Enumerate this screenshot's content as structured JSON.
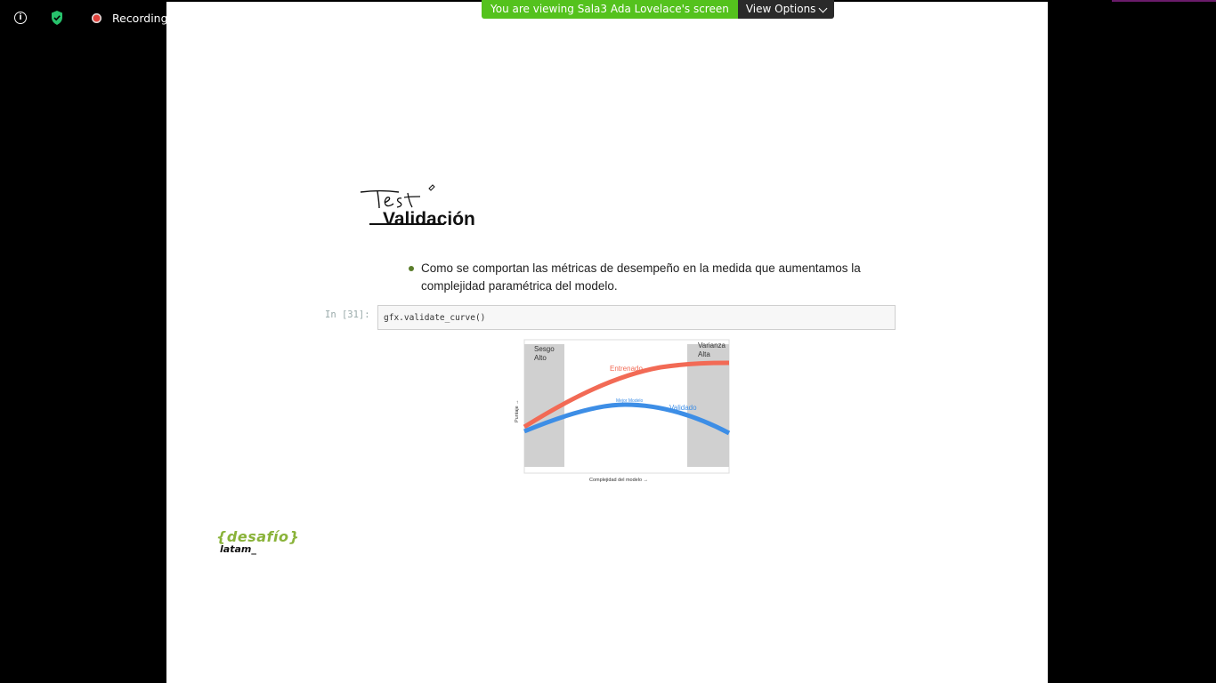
{
  "toolbar": {
    "info_icon": "info-icon",
    "shield_icon": "shield-icon",
    "recording_label": "Recording"
  },
  "share_banner": {
    "text": "You are viewing Sala3 Ada Lovelace's screen",
    "view_options_label": "View Options",
    "color": "#54c21d"
  },
  "slide": {
    "handwritten_note": "Test",
    "heading": "Validación",
    "bullet": "Como se comportan las métricas de desempeño en la medida que aumentamos la complejidad paramétrica del modelo.",
    "code_prompt": "In [31]:",
    "code": "gfx.validate_curve()",
    "logo_top": "{desafío}",
    "logo_bottom": "latam_"
  },
  "chart_data": {
    "type": "line",
    "xlabel": "Complejidad del modelo →",
    "ylabel": "Puntaje →",
    "regions": [
      "Sesgo Alto",
      "Varianza Alta"
    ],
    "series": [
      {
        "name": "Entrenado",
        "color": "#f26a55"
      },
      {
        "name": "Validado",
        "color": "#3d8ee6"
      }
    ],
    "annotation": "Mejor Modelo"
  }
}
